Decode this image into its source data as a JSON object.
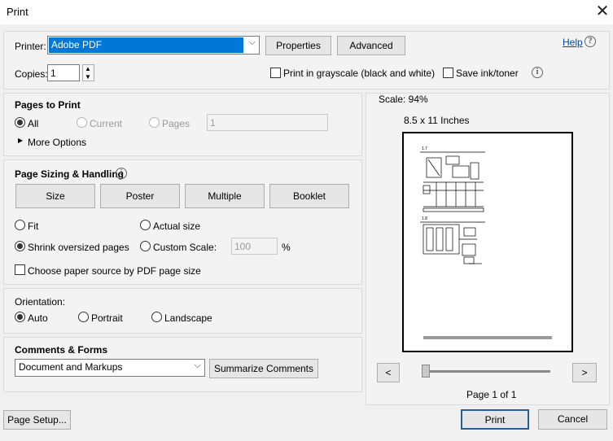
{
  "window": {
    "title": "Print",
    "close_icon": "close-icon"
  },
  "printer": {
    "label": "Printer:",
    "value": "Adobe PDF",
    "properties": "Properties",
    "advanced": "Advanced",
    "help": "Help",
    "copies_label": "Copies:",
    "copies_value": "1",
    "grayscale": "Print in grayscale (black and white)",
    "save_ink": "Save ink/toner"
  },
  "pages": {
    "heading": "Pages to Print",
    "all": "All",
    "current": "Current",
    "pages": "Pages",
    "pages_value": "1",
    "more": "More Options"
  },
  "sizing": {
    "heading": "Page Sizing & Handling",
    "tabs": [
      "Size",
      "Poster",
      "Multiple",
      "Booklet"
    ],
    "fit": "Fit",
    "actual": "Actual size",
    "shrink": "Shrink oversized pages",
    "custom": "Custom Scale:",
    "custom_value": "100",
    "percent": "%",
    "paper_source": "Choose paper source by PDF page size"
  },
  "orientation": {
    "heading": "Orientation:",
    "auto": "Auto",
    "portrait": "Portrait",
    "landscape": "Landscape"
  },
  "comments": {
    "heading": "Comments & Forms",
    "value": "Document and Markups",
    "summarize": "Summarize Comments"
  },
  "preview": {
    "scale": "Scale:  94%",
    "paper": "8.5 x 11 Inches",
    "page_status": "Page 1 of 1",
    "prev": "<",
    "next": ">",
    "slider_position": 0,
    "diagram_labels": [
      "1.7",
      "1.8"
    ]
  },
  "footer": {
    "page_setup": "Page Setup...",
    "print": "Print",
    "cancel": "Cancel"
  },
  "colors": {
    "accent": "#2b5d9b",
    "selection": "#0078d7"
  }
}
